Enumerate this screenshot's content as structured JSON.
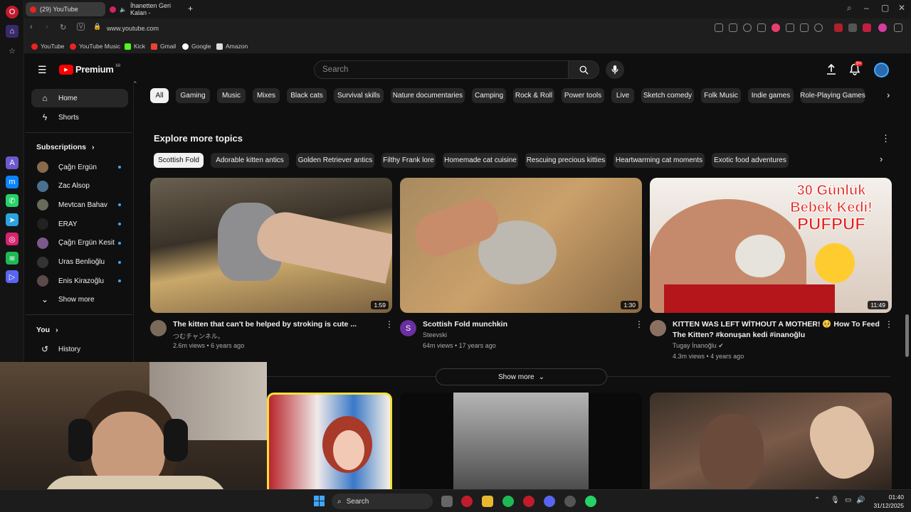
{
  "browser": {
    "tabs": [
      {
        "label": "(29) YouTube"
      },
      {
        "label": "İhanetten Geri Kalan -"
      }
    ],
    "url": "www.youtube.com",
    "bookmarks": [
      "YouTube",
      "YouTube Music",
      "Kick",
      "Gmail",
      "Google",
      "Amazon"
    ]
  },
  "header": {
    "logo": "Premium",
    "logo_sup": "68",
    "search_placeholder": "Search",
    "notif_count": "9+"
  },
  "sidebar": {
    "home": "Home",
    "shorts": "Shorts",
    "subscriptions_title": "Subscriptions",
    "subscriptions": [
      {
        "name": "Çağrı Ergün",
        "dot": true,
        "color": "#8a6a4a"
      },
      {
        "name": "Zac Alsop",
        "dot": false,
        "color": "#4a7090"
      },
      {
        "name": "Mevtcan Bahav",
        "dot": true,
        "color": "#6a6a5a"
      },
      {
        "name": "ERAY",
        "dot": true,
        "color": "#222222"
      },
      {
        "name": "Çağrı Ergün Kesit",
        "dot": true,
        "color": "#7a5a8a"
      },
      {
        "name": "Uras Benlioğlu",
        "dot": true,
        "color": "#333333"
      },
      {
        "name": "Enis Kirazoğlu",
        "dot": true,
        "color": "#5a4a4a"
      }
    ],
    "show_more": "Show more",
    "you": "You",
    "history": "History"
  },
  "chips": [
    "All",
    "Gaming",
    "Music",
    "Mixes",
    "Black cats",
    "Survival skills",
    "Nature documentaries",
    "Camping",
    "Rock & Roll",
    "Power tools",
    "Live",
    "Sketch comedy",
    "Folk Music",
    "Indie games",
    "Role-Playing Games"
  ],
  "explore": {
    "title": "Explore more topics",
    "topics": [
      "Scottish Fold",
      "Adorable kitten antics",
      "Golden Retriever antics",
      "Filthy Frank lore",
      "Homemade cat cuisine",
      "Rescuing precious kitties",
      "Heartwarming cat moments",
      "Exotic food adventures"
    ]
  },
  "videos": [
    {
      "title": "The kitten that can't be helped by stroking is cute ...",
      "title2": "",
      "channel": "つむチャンネル。",
      "meta": "2.6m views • 6 years ago",
      "duration": "1:59",
      "avatar_letter": ""
    },
    {
      "title": "Scottish Fold munchkin",
      "title2": "",
      "channel": "Steevski",
      "meta": "64m views • 17 years ago",
      "duration": "1:30",
      "avatar_letter": "S"
    },
    {
      "title": "KITTEN WAS LEFT WİTHOUT A MOTHER! 🥺 How To Feed",
      "title2": "The Kitten? #konuşan kedi #inanoğlu",
      "channel": "Tugay İnanoğlu",
      "meta": "4.3m views • 4 years ago",
      "duration": "11:49",
      "avatar_letter": ""
    }
  ],
  "thumb3_text": [
    "30 Günlük",
    "Bebek Kedi!",
    "PUFPUF"
  ],
  "show_more_btn": "Show more",
  "taskbar": {
    "search": "Search",
    "time": "01:40",
    "date": "31/12/2025"
  }
}
